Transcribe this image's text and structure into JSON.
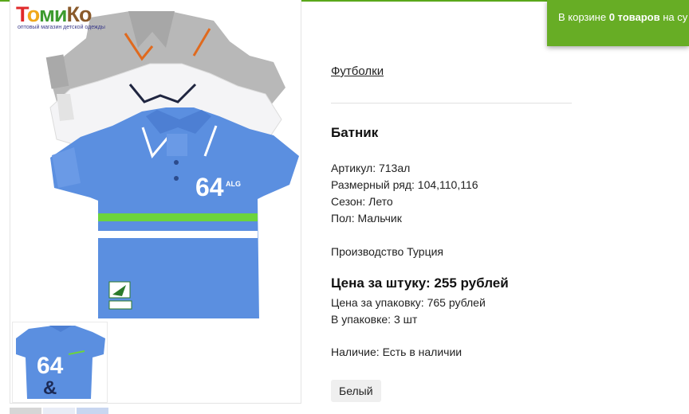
{
  "logo": {
    "word": [
      "Т",
      "о",
      "ми",
      "Ко"
    ],
    "tagline": "оптовый магазин детской одежды"
  },
  "cart": {
    "prefix": "В корзине ",
    "count": "0 товаров",
    "suffix": " на су"
  },
  "breadcrumb": "Футболки",
  "product": {
    "title": "Батник",
    "article": "Артикул: 713ал",
    "sizes": "Размерный ряд: 104,110,116",
    "season": "Сезон: Лето",
    "gender": "Пол: Мальчик",
    "origin": "Производство Турция",
    "price_unit": "Цена за штуку: 255 рублей",
    "price_pack": "Цена за упаковку: 765 рублей",
    "pack_qty": "В упаковке: 3 шт",
    "availability": "Наличие: Есть в наличии",
    "variant": "Белый"
  },
  "image_print": {
    "front_number": "64",
    "front_small": "ALG",
    "back_number": "64",
    "back_amp": "&"
  },
  "colors": {
    "accent_green": "#67ad25",
    "shirt_grey": "#b9b9b9",
    "shirt_white": "#f4f4f6",
    "shirt_blue": "#5b8fe0",
    "stripe_green": "#6cd43c"
  }
}
